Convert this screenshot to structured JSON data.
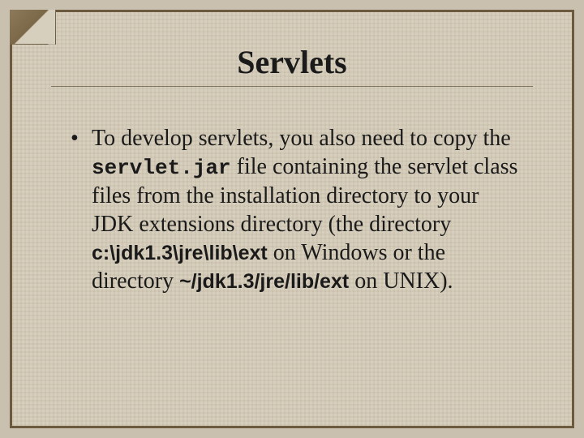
{
  "title": "Servlets",
  "bullet": {
    "t1": "To develop servlets, you also need to copy the ",
    "code1": "servlet.jar",
    "t2": " file containing the servlet class files from the installation directory to your JDK extensions directory (the directory ",
    "path_win": "c:\\jdk1.3\\jre\\lib\\ext",
    "t3": " on Windows or the directory ",
    "path_unix": "~/jdk1.3/jre/lib/ext",
    "t4": " on UNIX)."
  }
}
